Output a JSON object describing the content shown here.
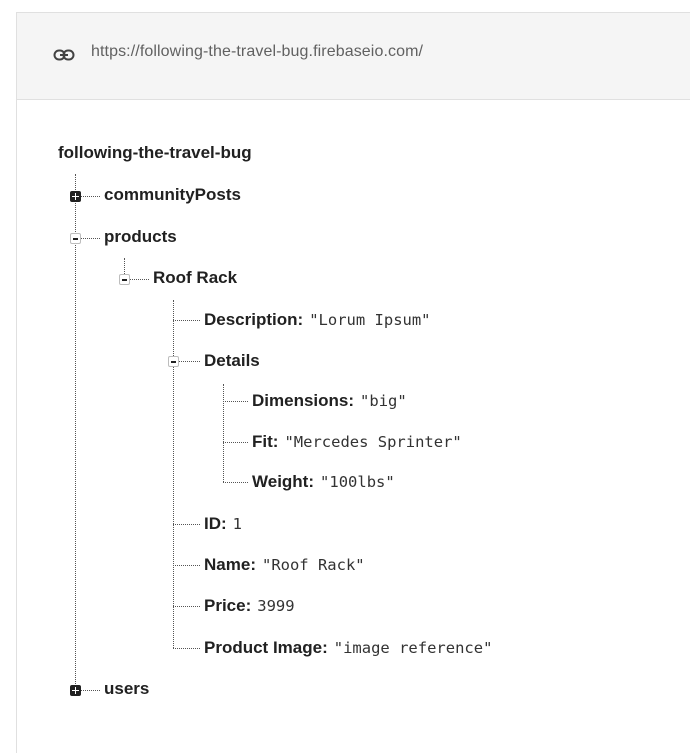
{
  "database_url": "https://following-the-travel-bug.firebaseio.com/",
  "root": {
    "name": "following-the-travel-bug",
    "children": [
      {
        "key": "communityPosts",
        "state": "collapsed"
      },
      {
        "key": "products",
        "state": "expanded",
        "children": [
          {
            "key": "Roof Rack",
            "state": "expanded",
            "children": [
              {
                "key": "Description",
                "value": "\"Lorum Ipsum\""
              },
              {
                "key": "Details",
                "state": "expanded",
                "children": [
                  {
                    "key": "Dimensions",
                    "value": "\"big\""
                  },
                  {
                    "key": "Fit",
                    "value": "\"Mercedes Sprinter\""
                  },
                  {
                    "key": "Weight",
                    "value": "\"100lbs\""
                  }
                ]
              },
              {
                "key": "ID",
                "value": "1"
              },
              {
                "key": "Name",
                "value": "\"Roof Rack\""
              },
              {
                "key": "Price",
                "value": "3999"
              },
              {
                "key": "Product Image",
                "value": "\"image reference\""
              }
            ]
          }
        ]
      },
      {
        "key": "users",
        "state": "collapsed"
      }
    ]
  },
  "icons": {
    "url": "link-icon",
    "collapsed": "plus-box-icon",
    "expanded": "minus-box-icon"
  }
}
